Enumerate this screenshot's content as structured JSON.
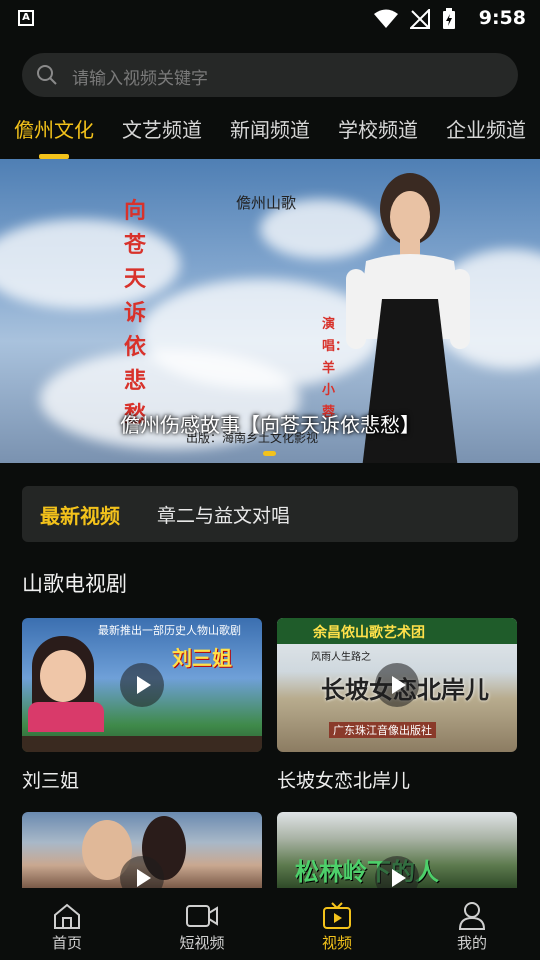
{
  "status_bar": {
    "time": "9:58",
    "app_icon_letter": "A"
  },
  "search": {
    "placeholder": "请输入视频关键字"
  },
  "tabs": [
    {
      "label": "儋州文化",
      "active": true
    },
    {
      "label": "文艺频道",
      "active": false
    },
    {
      "label": "新闻频道",
      "active": false
    },
    {
      "label": "学校频道",
      "active": false
    },
    {
      "label": "企业频道",
      "active": false
    }
  ],
  "banner": {
    "top_label": "儋州山歌",
    "vertical_title": "向苍天诉依悲愁",
    "vertical_sub": "演唱：羊小蓉",
    "caption": "儋州伤感故事【向苍天诉依悲愁】",
    "publisher": "出版：海南乡土文化影视"
  },
  "latest": {
    "tag": "最新视频",
    "title": "章二与益文对唱"
  },
  "section": {
    "title": "山歌电视剧"
  },
  "videos": [
    {
      "name": "刘三姐",
      "thumb_title": "刘三姐",
      "thumb_banner": "最新推出一部历史人物山歌剧"
    },
    {
      "name": "长坡女恋北岸儿",
      "thumb_title": "长坡女恋北岸儿",
      "thumb_banner": "余昌侬山歌艺术团",
      "thumb_sub": "风雨人生路之",
      "thumb_footer": "广东珠江音像出版社"
    },
    {
      "name": "",
      "thumb_title": ""
    },
    {
      "name": "",
      "thumb_title": "松林岭下的人"
    }
  ],
  "bottom_nav": [
    {
      "label": "首页",
      "icon": "home-icon",
      "active": false
    },
    {
      "label": "短视频",
      "icon": "video-camera-icon",
      "active": false
    },
    {
      "label": "视频",
      "icon": "tv-play-icon",
      "active": true
    },
    {
      "label": "我的",
      "icon": "user-icon",
      "active": false
    }
  ],
  "colors": {
    "accent": "#f3c21b",
    "background": "#0b0d0c",
    "surface": "#242625"
  }
}
